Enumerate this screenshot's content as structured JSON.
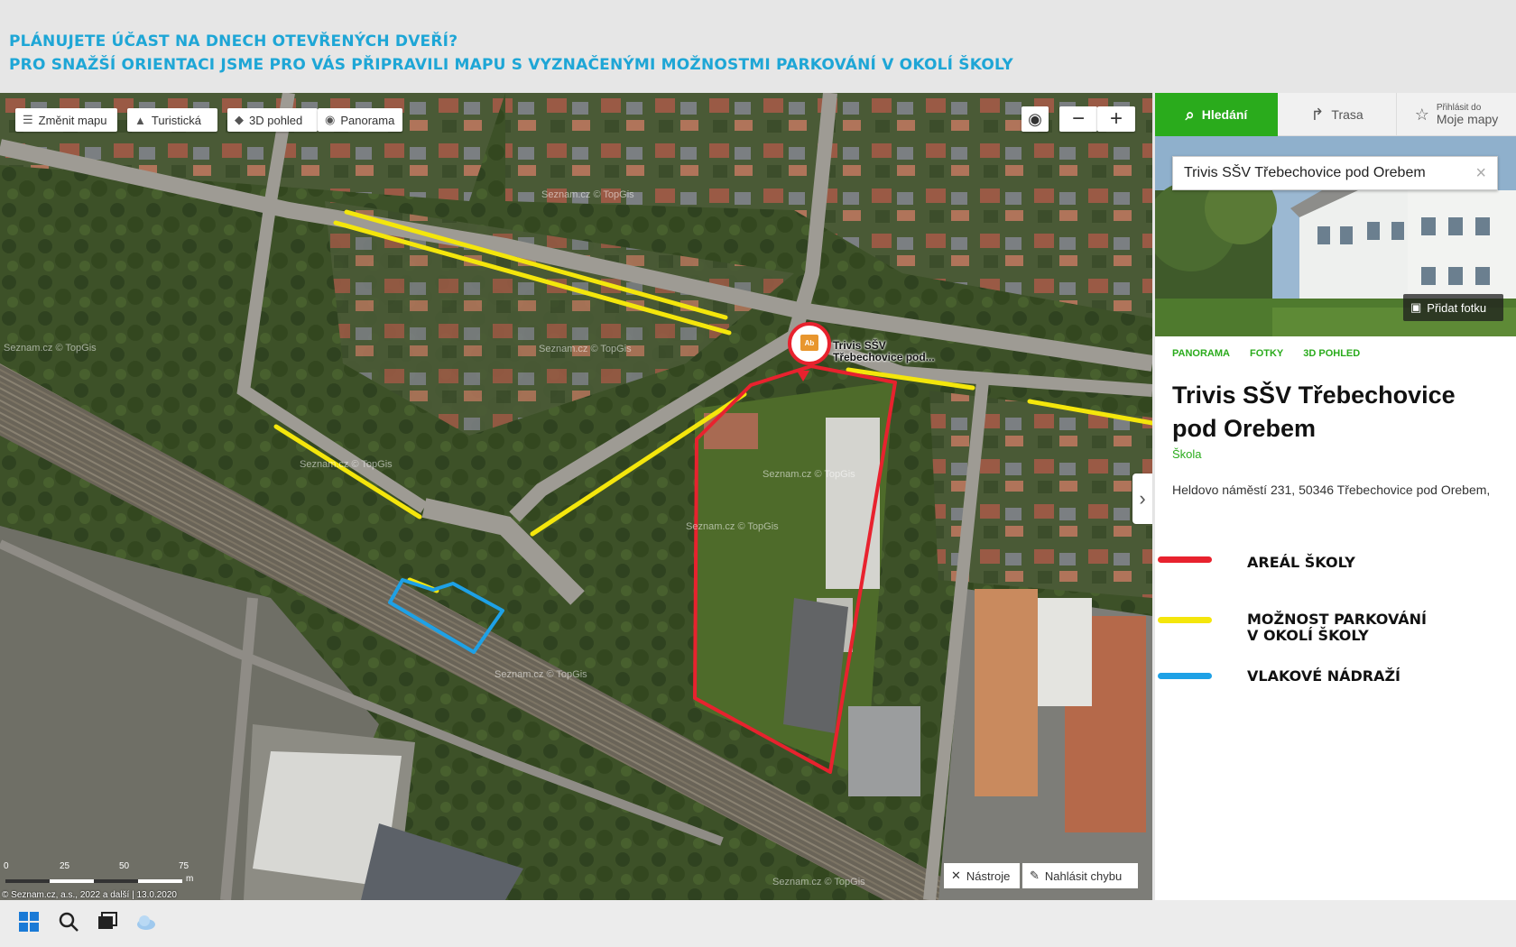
{
  "banner": {
    "line1": "PLÁNUJETE ÚČAST NA DNECH OTEVŘENÝCH DVEŘÍ?",
    "line2": "PRO SNAŽŠÍ ORIENTACI JSME PRO VÁS PŘIPRAVILI MAPU S VYZNAČENÝMI MOŽNOSTMI  PARKOVÁNÍ V OKOLÍ ŠKOLY"
  },
  "map_controls": {
    "change_map": "Změnit mapu",
    "tourist": "Turistická",
    "view3d": "3D pohled",
    "panorama": "Panorama",
    "zoom_out": "−",
    "zoom_in": "+"
  },
  "poi": {
    "label_line1": "Trivis SŠV",
    "label_line2": "Třebechovice pod..."
  },
  "watermark": "Seznam.cz  © TopGis",
  "scale": {
    "ticks": [
      "0",
      "25",
      "50",
      "75"
    ],
    "unit": "m"
  },
  "copyright": "© Seznam.cz, a.s., 2022 a další | 13.0.2020",
  "tools": {
    "tools_label": "Nástroje",
    "report_label": "Nahlásit chybu"
  },
  "panel": {
    "tabs": {
      "search": "Hledání",
      "route": "Trasa",
      "login_small": "Přihlásit do",
      "login_big": "Moje mapy"
    },
    "search_value": "Trivis  SŠV Třebechovice pod Orebem",
    "add_photo": "Přidat fotku",
    "links": [
      "PANORAMA",
      "FOTKY",
      "3D POHLED"
    ],
    "title": "Trivis SŠV Třebechovice pod Orebem",
    "type": "Škola",
    "address": "Heldovo náměstí 231, 50346 Třebechovice pod Orebem,"
  },
  "legend": [
    {
      "label": "AREÁL ŠKOLY",
      "color": "#e8222e"
    },
    {
      "label": "MOŽNOST PARKOVÁNÍ V OKOLÍ ŠKOLY",
      "color": "#f4e60c"
    },
    {
      "label": "VLAKOVÉ NÁDRAŽÍ",
      "color": "#1ea1e6"
    }
  ],
  "colors": {
    "accent_green": "#2aab1c",
    "banner_blue": "#1ea6d6"
  }
}
